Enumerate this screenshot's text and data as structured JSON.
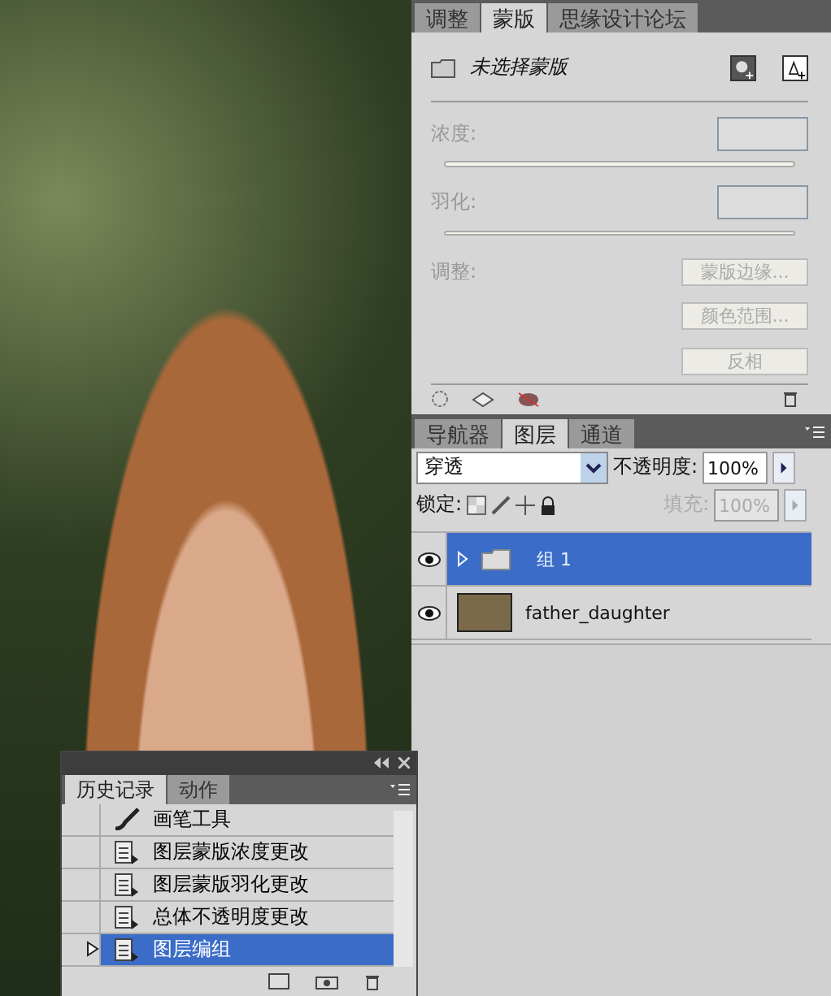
{
  "mask_panel": {
    "tabs": [
      {
        "label": "调整",
        "selected": false
      },
      {
        "label": "蒙版",
        "selected": true
      },
      {
        "label": "思缘设计论坛",
        "selected": false
      }
    ],
    "status": "未选择蒙版",
    "density_label": "浓度:",
    "density_disabled": true,
    "feather_label": "羽化:",
    "feather_disabled": true,
    "adjust_label": "调整:",
    "buttons": [
      {
        "label": "蒙版边缘...",
        "disabled": true
      },
      {
        "label": "颜色范围...",
        "disabled": true
      },
      {
        "label": "反相",
        "disabled": true
      }
    ]
  },
  "layers_panel": {
    "tabs": [
      {
        "label": "导航器",
        "selected": false
      },
      {
        "label": "图层",
        "selected": true
      },
      {
        "label": "通道",
        "selected": false
      }
    ],
    "blend_mode": "穿透",
    "opacity_label": "不透明度:",
    "opacity": "100%",
    "lock_label": "锁定:",
    "fill_label": "填充:",
    "fill": "100%",
    "fill_disabled": true,
    "layers": [
      {
        "name": "组 1",
        "kind": "group",
        "selected": true,
        "visible": true
      },
      {
        "name": "father_daughter",
        "kind": "image",
        "selected": false,
        "visible": true
      }
    ]
  },
  "history_panel": {
    "tabs": [
      {
        "label": "历史记录",
        "selected": true
      },
      {
        "label": "动作",
        "selected": false
      }
    ],
    "items": [
      {
        "label": "画笔工具",
        "kind": "brush",
        "selected": false
      },
      {
        "label": "图层蒙版浓度更改",
        "kind": "doc",
        "selected": false
      },
      {
        "label": "图层蒙版羽化更改",
        "kind": "doc",
        "selected": false
      },
      {
        "label": "总体不透明度更改",
        "kind": "doc",
        "selected": false
      },
      {
        "label": "图层编组",
        "kind": "doc",
        "selected": true
      }
    ]
  }
}
